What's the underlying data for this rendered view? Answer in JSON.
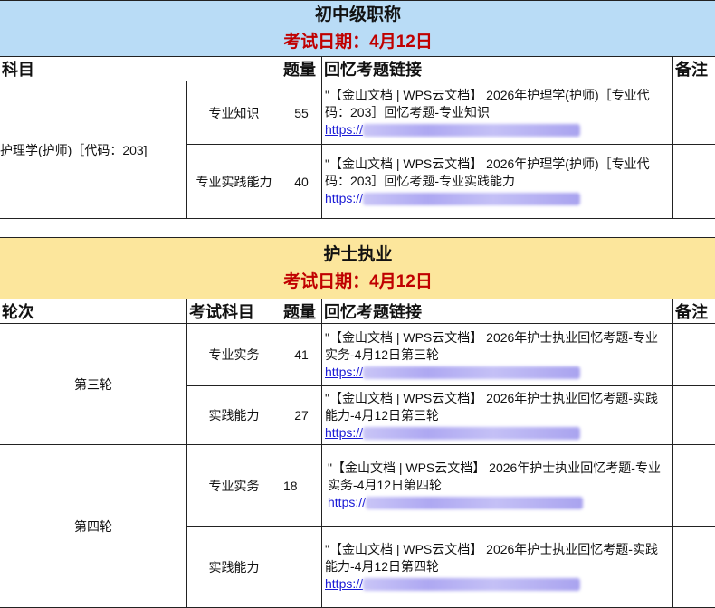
{
  "section1": {
    "title": "初中级职称",
    "date": "考试日期：4月12日",
    "headers": [
      "科目",
      "题量",
      "回忆考题链接",
      "备注"
    ],
    "subject": "护理学(护师)［代码：203]",
    "rows": [
      {
        "sub": "专业知识",
        "count": "55",
        "text": "\"【金山文档 | WPS云文档】 2026年护理学(护师)［专业代码：203］回忆考题-专业知识",
        "url": "https://"
      },
      {
        "sub": "专业实践能力",
        "count": "40",
        "text": "\"【金山文档 | WPS云文档】 2026年护理学(护师)［专业代码：203］回忆考题-专业实践能力",
        "url": "https://"
      }
    ]
  },
  "section2": {
    "title": "护士执业",
    "date": "考试日期：4月12日",
    "headers": [
      "轮次",
      "考试科目",
      "题量",
      "回忆考题链接",
      "备注"
    ],
    "rounds": [
      {
        "name": "第三轮",
        "rows": [
          {
            "sub": "专业实务",
            "count": "41",
            "text": "\"【金山文档 | WPS云文档】 2026年护士执业回忆考题-专业实务-4月12日第三轮",
            "url": "https://"
          },
          {
            "sub": "实践能力",
            "count": "27",
            "text": "\"【金山文档 | WPS云文档】 2026年护士执业回忆考题-实践能力-4月12日第三轮",
            "url": "https://"
          }
        ]
      },
      {
        "name": "第四轮",
        "rows": [
          {
            "sub": "专业实务",
            "count": "18",
            "text": "\"【金山文档 | WPS云文档】 2026年护士执业回忆考题-专业实务-4月12日第四轮",
            "url": "https://"
          },
          {
            "sub": "实践能力",
            "count": "",
            "text": "\"【金山文档 | WPS云文档】 2026年护士执业回忆考题-实践能力-4月12日第四轮",
            "url": "https://"
          }
        ]
      }
    ]
  }
}
